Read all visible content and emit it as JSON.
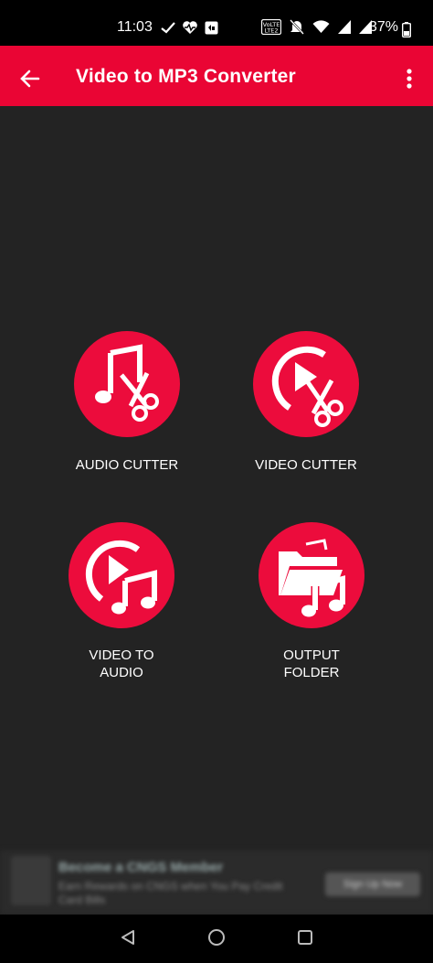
{
  "status_bar": {
    "time": "11:03",
    "battery": "37%",
    "left_icons": [
      "missed-call-icon",
      "heart-pulse-icon",
      "app-notification-icon"
    ],
    "right_icons": [
      "volte-icon",
      "mute-icon",
      "wifi-icon",
      "signal-1-icon",
      "signal-2-icon"
    ]
  },
  "app_bar": {
    "title": "Video to MP3 Converter",
    "back_icon": "arrow-left-icon",
    "menu_icon": "more-vert-icon",
    "color": "#ea0534"
  },
  "tiles": [
    {
      "id": "audio-cutter",
      "label": "AUDIO CUTTER",
      "icon": "music-scissors-icon"
    },
    {
      "id": "video-cutter",
      "label": "VIDEO CUTTER",
      "icon": "play-scissors-icon"
    },
    {
      "id": "video-to-audio",
      "label": "VIDEO TO\nAUDIO",
      "icon": "play-music-icon"
    },
    {
      "id": "output-folder",
      "label": "OUTPUT\nFOLDER",
      "icon": "folder-music-icon"
    }
  ],
  "accent_color": "#ec0c3c",
  "ad": {
    "title": "Become a CNGS Member",
    "subtitle": "Earn Rewards on CNGS when You Pay Credit Card Bills",
    "cta": "Sign Up Now"
  },
  "nav_bar": {
    "buttons": [
      "back-triangle-icon",
      "home-circle-icon",
      "recents-square-icon"
    ]
  }
}
